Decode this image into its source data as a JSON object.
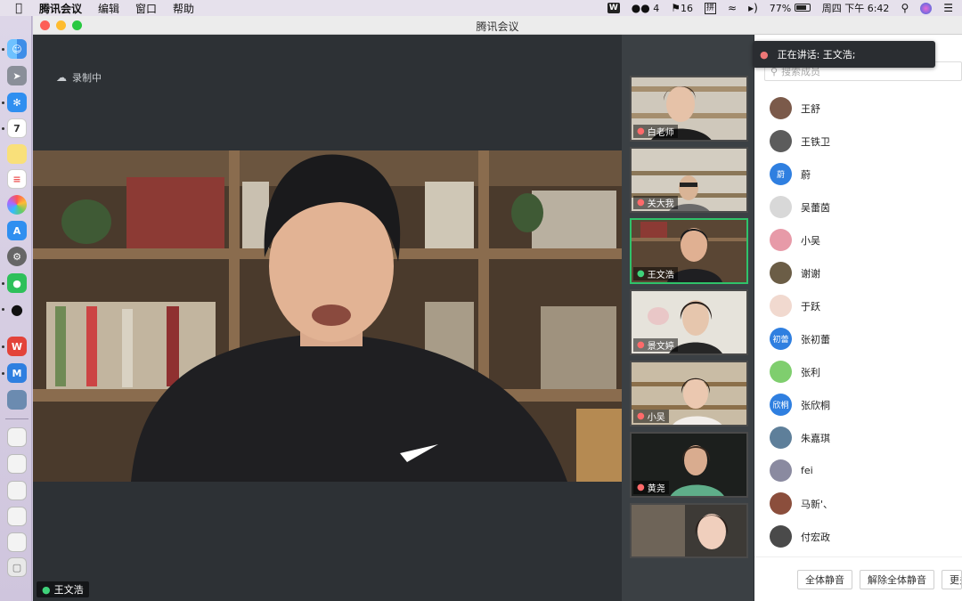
{
  "menubar": {
    "app": "腾讯会议",
    "items": [
      "编辑",
      "窗口",
      "帮助"
    ],
    "status": {
      "wechat_count": "4",
      "bell_count": "16",
      "ime": "拼",
      "battery": "77%",
      "clock": "周四 下午 6:42"
    }
  },
  "window": {
    "title": "腾讯会议"
  },
  "recording": {
    "label": "录制中"
  },
  "main_speaker": {
    "name": "王文浩"
  },
  "speaking_toast": {
    "text": "正在讲话: 王文浩;"
  },
  "thumbnails": [
    {
      "name": "白老师",
      "mic": "off",
      "active": false
    },
    {
      "name": "关大我",
      "mic": "off",
      "active": false
    },
    {
      "name": "王文浩",
      "mic": "on",
      "active": true
    },
    {
      "name": "景文婷",
      "mic": "off",
      "active": false
    },
    {
      "name": "小吴",
      "mic": "off",
      "active": false
    },
    {
      "name": "黄尧",
      "mic": "off",
      "active": false
    },
    {
      "name": "",
      "mic": "none",
      "active": false
    }
  ],
  "members": {
    "search_placeholder": "搜索成员",
    "list": [
      {
        "name": "王舒",
        "avatar_text": "",
        "avatar_color": "#7b5a4a"
      },
      {
        "name": "王铁卫",
        "avatar_text": "",
        "avatar_color": "#5c5c5c"
      },
      {
        "name": "蔚",
        "avatar_text": "蔚",
        "avatar_color": "#2f7fe0"
      },
      {
        "name": "吴蕾茵",
        "avatar_text": "",
        "avatar_color": "#d8d8d8"
      },
      {
        "name": "小吴",
        "avatar_text": "",
        "avatar_color": "#e79aa8"
      },
      {
        "name": "谢谢",
        "avatar_text": "",
        "avatar_color": "#6b5d46"
      },
      {
        "name": "于跃",
        "avatar_text": "",
        "avatar_color": "#f1d9cf"
      },
      {
        "name": "张初蕾",
        "avatar_text": "初蕾",
        "avatar_color": "#2f7fe0"
      },
      {
        "name": "张利",
        "avatar_text": "",
        "avatar_color": "#7fce6e"
      },
      {
        "name": "张欣桐",
        "avatar_text": "欣桐",
        "avatar_color": "#2f7fe0"
      },
      {
        "name": "朱嘉琪",
        "avatar_text": "",
        "avatar_color": "#5e7f9a"
      },
      {
        "name": "fei",
        "avatar_text": "",
        "avatar_color": "#8a8aa0"
      },
      {
        "name": "马新'、",
        "avatar_text": "",
        "avatar_color": "#8b4e3c"
      },
      {
        "name": "付宏政",
        "avatar_text": "",
        "avatar_color": "#4a4a4a"
      }
    ],
    "buttons": {
      "mute_all": "全体静音",
      "unmute_all": "解除全体静音",
      "more": "更多"
    }
  }
}
